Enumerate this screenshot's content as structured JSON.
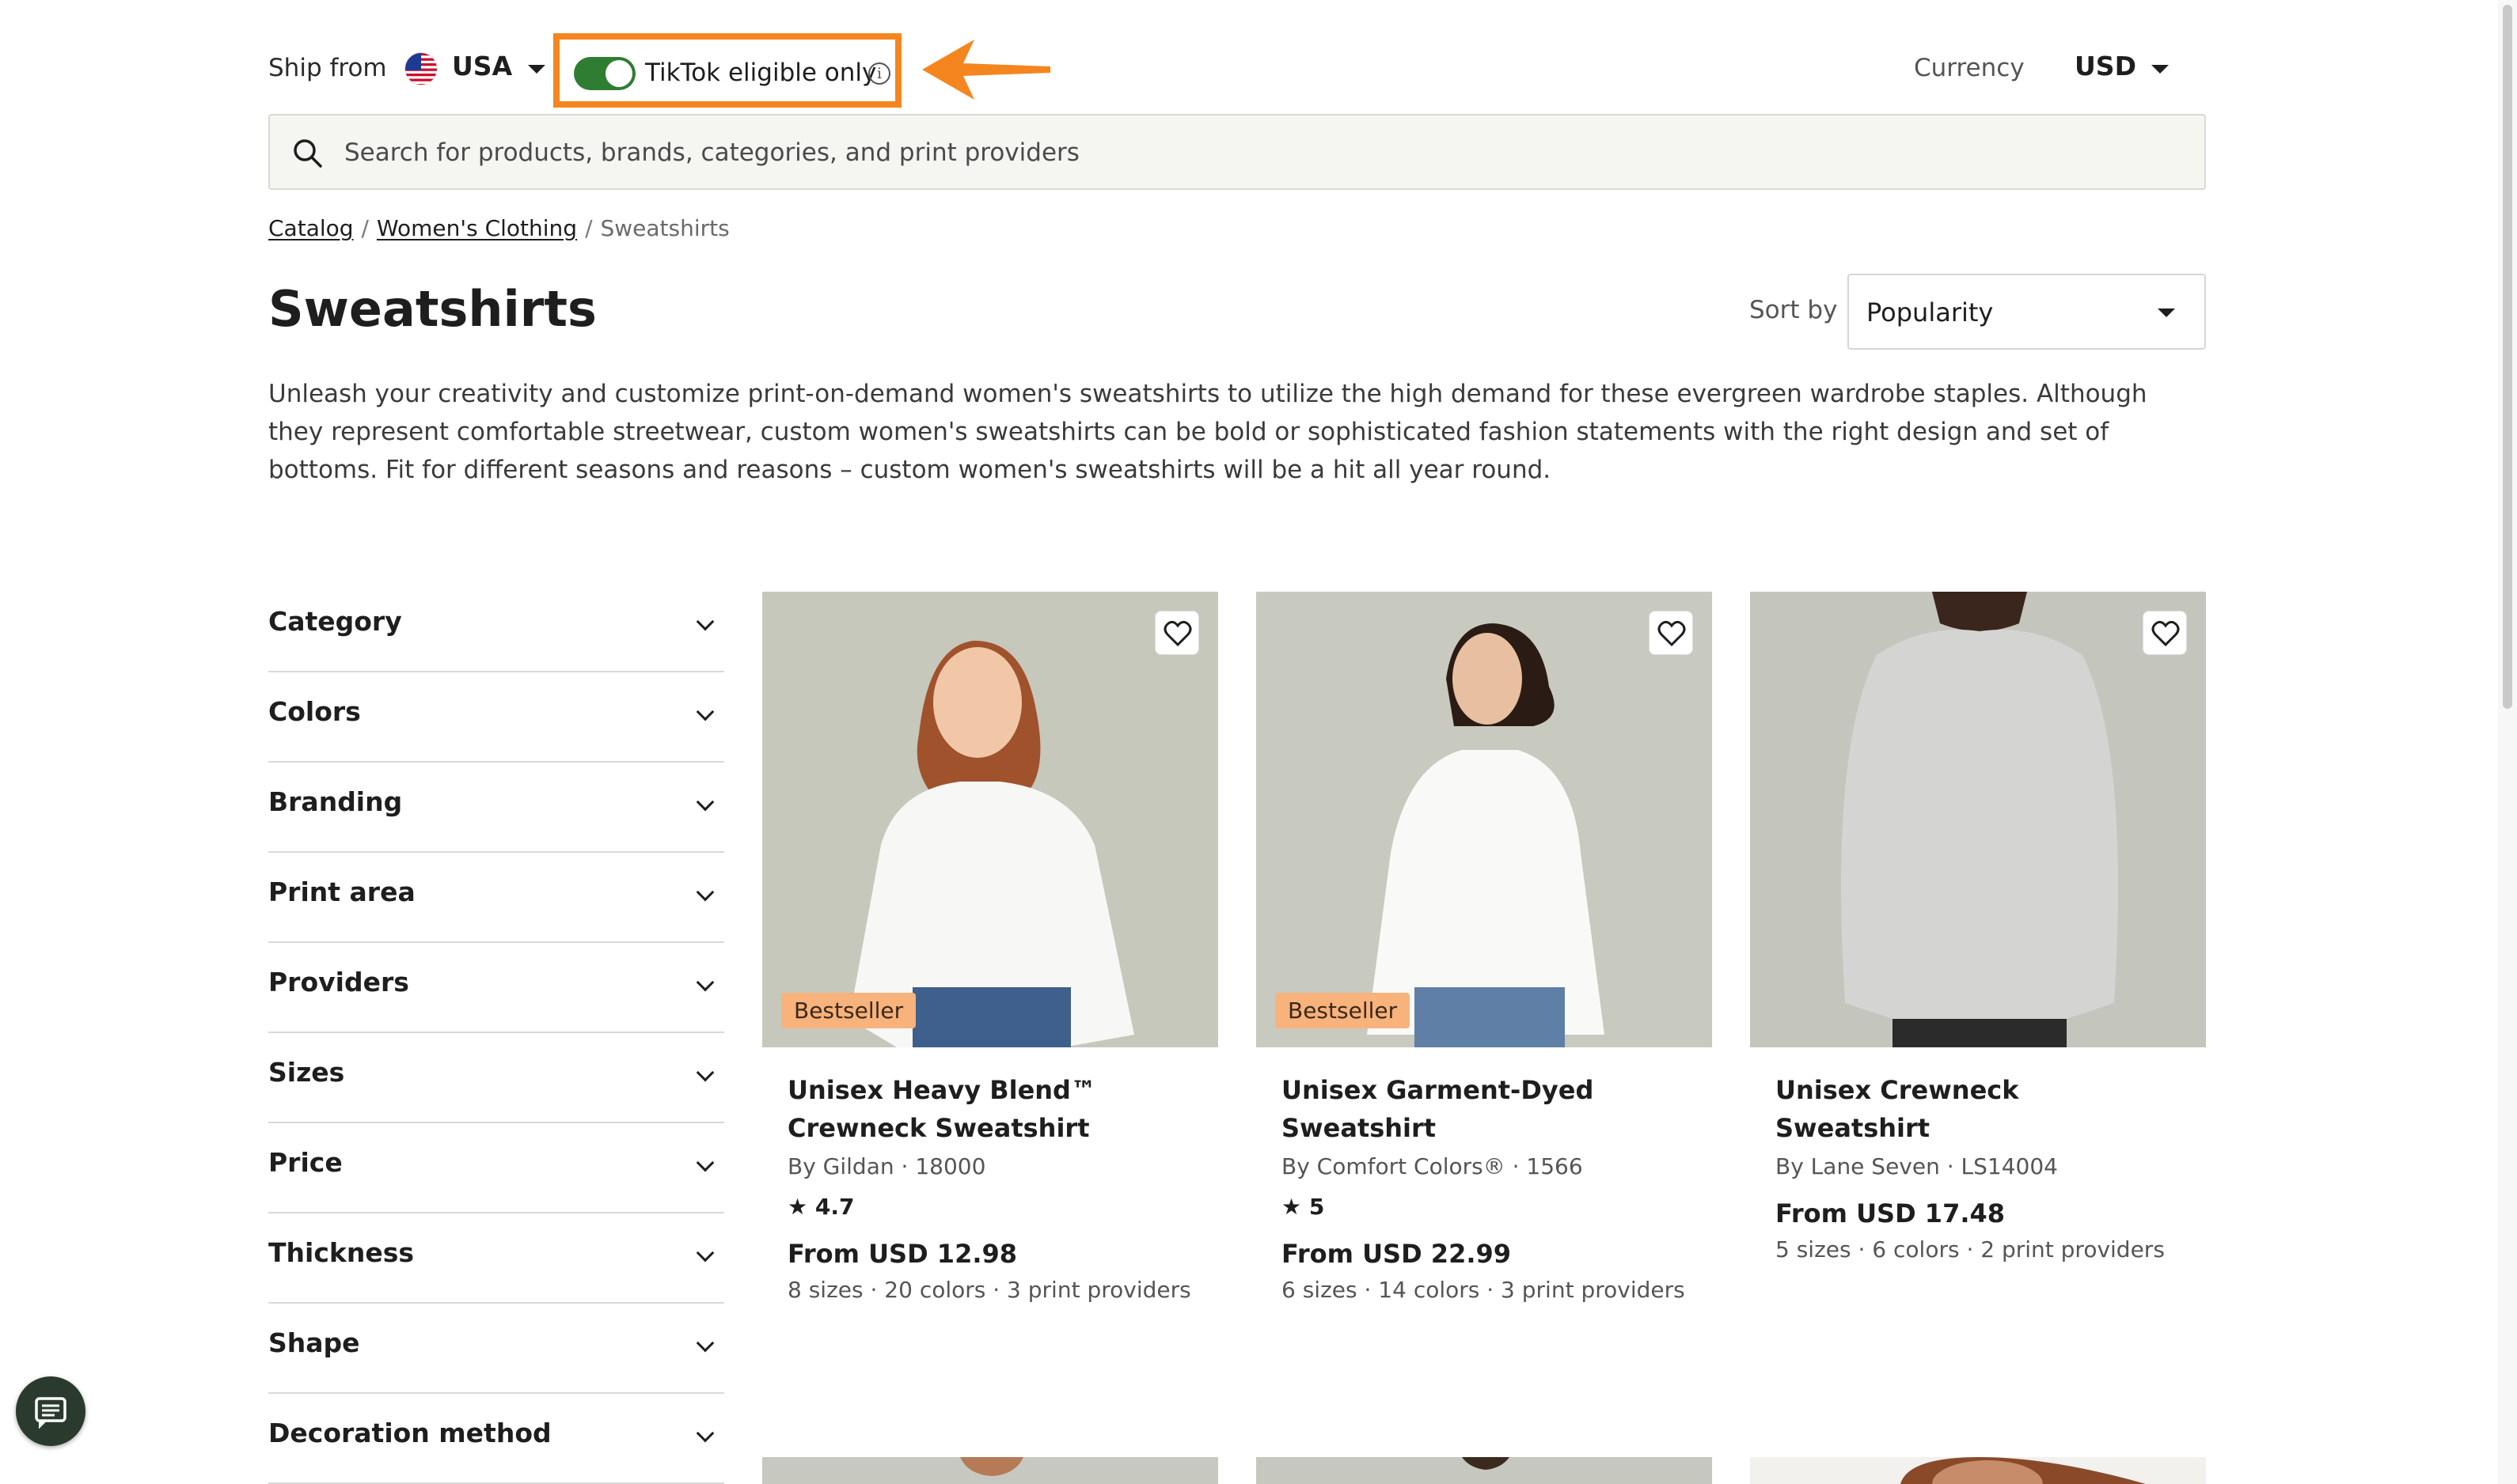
{
  "header": {
    "ship_from_label": "Ship from",
    "ship_from_country": "USA",
    "tiktok_toggle_label": "TikTok eligible only",
    "tiktok_toggle_on": true,
    "currency_label": "Currency",
    "currency_value": "USD"
  },
  "search": {
    "placeholder": "Search for products, brands, categories, and print providers"
  },
  "breadcrumb": {
    "items": [
      "Catalog",
      "Women's Clothing"
    ],
    "current": "Sweatshirts"
  },
  "page": {
    "title": "Sweatshirts",
    "sort_label": "Sort by",
    "sort_value": "Popularity",
    "description": "Unleash your creativity and customize print-on-demand women's sweatshirts to utilize the high demand for these evergreen wardrobe staples. Although they represent comfortable streetwear, custom women's sweatshirts can be bold or sophisticated fashion statements with the right design and set of bottoms. Fit for different seasons and reasons – custom women's sweatshirts will be a hit all year round."
  },
  "filters": [
    "Category",
    "Colors",
    "Branding",
    "Print area",
    "Providers",
    "Sizes",
    "Price",
    "Thickness",
    "Shape",
    "Decoration method"
  ],
  "products": [
    {
      "name": "Unisex Heavy Blend™ Crewneck Sweatshirt",
      "by": "By Gildan · 18000",
      "badge": "Bestseller",
      "rating": "4.7",
      "price": "From USD 12.98",
      "meta": "8 sizes · 20 colors · 3 print providers"
    },
    {
      "name": "Unisex Garment-Dyed Sweatshirt",
      "by": "By Comfort Colors® · 1566",
      "badge": "Bestseller",
      "rating": "5",
      "price": "From USD 22.99",
      "meta": "6 sizes · 14 colors · 3 print providers"
    },
    {
      "name": "Unisex Crewneck Sweatshirt",
      "by": "By Lane Seven · LS14004",
      "badge": "",
      "rating": "",
      "price": "From USD 17.48",
      "meta": "5 sizes · 6 colors · 2 print providers"
    }
  ],
  "colors": {
    "highlight": "#f5861f",
    "toggle_on": "#2f7d32",
    "badge": "#f8b27c",
    "chat_button": "#2a3a2c"
  }
}
